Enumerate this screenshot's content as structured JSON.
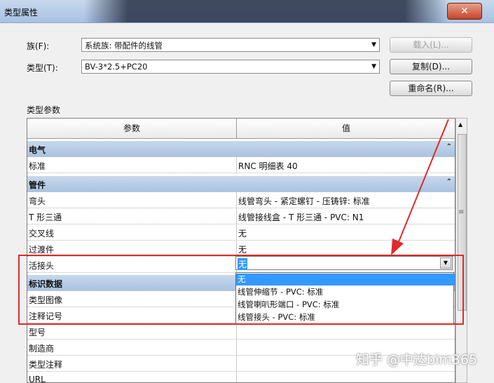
{
  "window": {
    "title": "类型属性",
    "close_glyph": "✕"
  },
  "family": {
    "label": "族(F):",
    "value": "系统族: 带配件的线管",
    "load_button": "载入(L)..."
  },
  "type": {
    "label": "类型(T):",
    "value": "BV-3*2.5+PC20",
    "duplicate_button": "复制(D)...",
    "rename_button": "重命名(R)..."
  },
  "params_section": "类型参数",
  "grid": {
    "header": {
      "param": "参数",
      "value": "值"
    },
    "groups": {
      "electrical": "电气",
      "fittings": "管件",
      "identity": "标识数据"
    },
    "rows": {
      "standard": {
        "p": "标准",
        "v": "RNC 明细表 40"
      },
      "elbow": {
        "p": "弯头",
        "v": "线管弯头 - 紧定螺钉 - 压铸锌: 标准"
      },
      "tee": {
        "p": "T 形三通",
        "v": "线管接线盒 - T 形三通 - PVC: N1"
      },
      "cross": {
        "p": "交叉线",
        "v": "无"
      },
      "transition": {
        "p": "过渡件",
        "v": "无"
      },
      "union": {
        "p": "活接头",
        "v": "无"
      },
      "type_image": {
        "p": "类型图像",
        "v": ""
      },
      "type_mark": {
        "p": "注释记号",
        "v": ""
      },
      "model": {
        "p": "型号",
        "v": ""
      },
      "manufacturer": {
        "p": "制造商",
        "v": ""
      },
      "type_comments": {
        "p": "类型注释",
        "v": ""
      },
      "url": {
        "p": "URL",
        "v": ""
      }
    }
  },
  "union_dropdown": {
    "selected": "无",
    "options": [
      "无",
      "线管伸缩节 - PVC: 标准",
      "线管喇叭形端口 - PVC: 标准",
      "线管接头 - PVC: 标准"
    ]
  },
  "watermark": "知乎 @中达bim365",
  "colors": {
    "highlight": "#3399ff",
    "annotation": "#e02a2a",
    "group_header": "#b8cde7"
  }
}
